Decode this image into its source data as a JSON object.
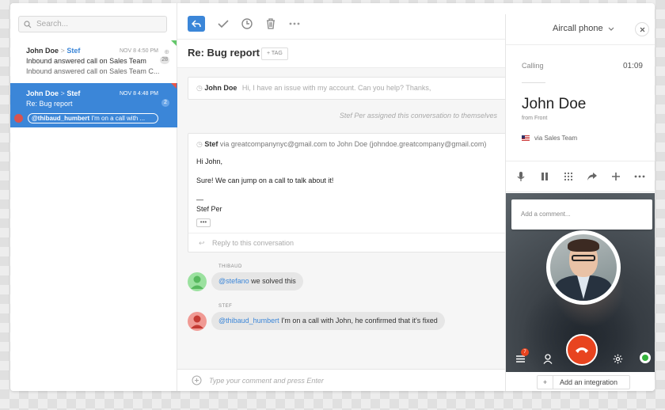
{
  "sidebar": {
    "search_placeholder": "Search...",
    "conversations": [
      {
        "from": "John Doe",
        "to": "Stef",
        "date": "NOV 8 4:50 PM",
        "subject": "Inbound answered call on Sales Team",
        "preview": "Inbound answered call on Sales Team C...",
        "badge": "28"
      },
      {
        "from": "John Doe",
        "to": "Stef",
        "date": "NOV 8 4:48 PM",
        "subject": "Re: Bug report",
        "badge": "2",
        "mention_handle": "@thibaud_humbert",
        "mention_text": " I'm on a call with ..."
      }
    ]
  },
  "main": {
    "subject": "Re: Bug report",
    "tag_label": "+ TAG",
    "collapsed_message": {
      "from": "John Doe",
      "preview": "Hi, I have an issue with my account. Can you help? Thanks,"
    },
    "assign_note": "Stef Per assigned this conversation to themselves",
    "open_message": {
      "from": "Stef",
      "meta": "via greatcompanynyc@gmail.com to John Doe (johndoe.greatcompany@gmail.com)",
      "greeting": "Hi John,",
      "body": "Sure! We can jump on a call to talk about it!",
      "sig_dash": "—",
      "signature": "Stef Per",
      "more": "•••",
      "reply_label": "Reply to this conversation"
    },
    "comments": [
      {
        "author": "THIBAUD",
        "mention": "@stefano",
        "text": " we solved this"
      },
      {
        "author": "STEF",
        "mention": "@thibaud_humbert",
        "text": " I'm on a call with John, he confirmed that it's fixed"
      }
    ],
    "composer_placeholder": "Type your comment and press Enter"
  },
  "phone": {
    "title": "Aircall phone",
    "status": "Calling",
    "timer": "01:09",
    "caller_name": "John Doe",
    "caller_from": "from Front",
    "via": "via Sales Team",
    "comment_placeholder": "Add a comment...",
    "notification_count": "7",
    "integration_plus": "+",
    "integration_label": "Add an integration"
  },
  "colors": {
    "accent": "#3b86d8",
    "hangup": "#e8441f",
    "online": "#34b33c"
  }
}
